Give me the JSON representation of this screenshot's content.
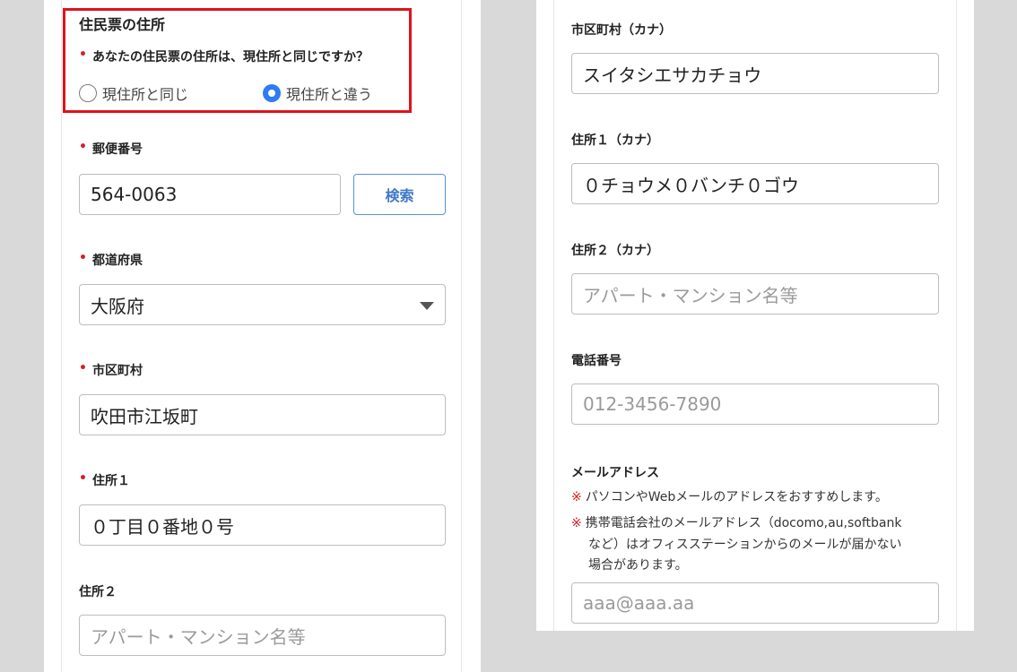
{
  "left": {
    "section_title": "住民票の住所",
    "question": "あなたの住民票の住所は、現住所と同じですか？",
    "radio_same": "現住所と同じ",
    "radio_diff": "現住所と違う",
    "postal_label": "郵便番号",
    "postal_value": "564-0063",
    "search_label": "検索",
    "pref_label": "都道府県",
    "pref_value": "大阪府",
    "city_label": "市区町村",
    "city_value": "吹田市江坂町",
    "addr1_label": "住所１",
    "addr1_value": "０丁目０番地０号",
    "addr2_label": "住所２",
    "addr2_placeholder": "アパート・マンション名等"
  },
  "right": {
    "city_kana_label": "市区町村（カナ）",
    "city_kana_value": "スイタシエサカチョウ",
    "addr1_kana_label": "住所１（カナ）",
    "addr1_kana_value": "０チョウメ０バンチ０ゴウ",
    "addr2_kana_label": "住所２（カナ）",
    "addr2_kana_placeholder": "アパート・マンション名等",
    "phone_label": "電話番号",
    "phone_placeholder": "012-3456-7890",
    "email_label": "メールアドレス",
    "note_mark": "※",
    "note1": "パソコンやWebメールのアドレスをおすすめします。",
    "note2_line1": "携帯電話会社のメールアドレス（docomo,au,softbank",
    "note2_line2": "など）はオフィスステーションからのメールが届かない",
    "note2_line3": "場合があります。",
    "email_placeholder": "aaa@aaa.aa"
  },
  "required_mark": "•"
}
